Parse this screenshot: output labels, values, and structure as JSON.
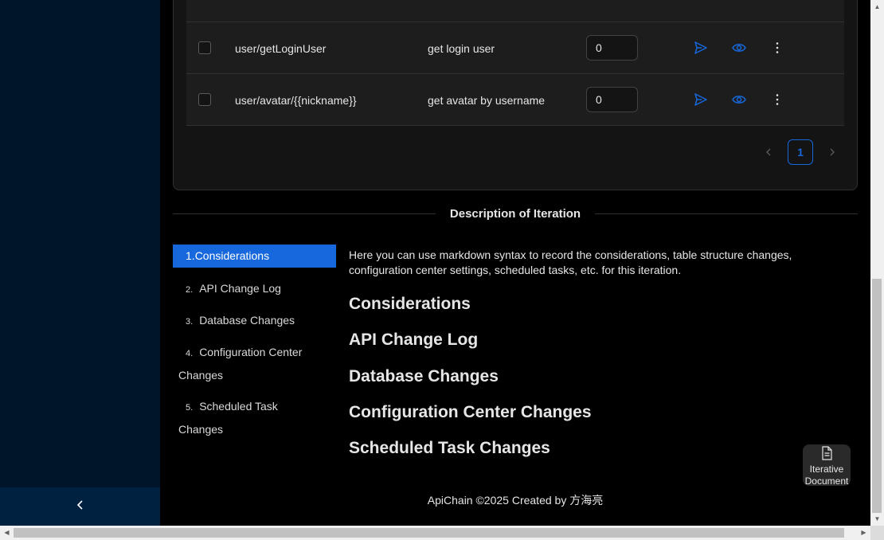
{
  "sidebar": {
    "collapse_icon": "chevron-left-icon"
  },
  "table": {
    "rows": [
      {
        "path": "user/getLoginUser",
        "description": "get login user",
        "value": "0"
      },
      {
        "path": "user/avatar/{{nickname}}",
        "description": "get avatar by username",
        "value": "0"
      }
    ],
    "row_icons": [
      "send-icon",
      "eye-icon",
      "more-vertical-icon"
    ]
  },
  "pagination": {
    "current_page": "1"
  },
  "section": {
    "title": "Description of Iteration"
  },
  "toc": {
    "items": [
      {
        "num": "1.",
        "label": "Considerations"
      },
      {
        "num": "2.",
        "label": "API Change Log"
      },
      {
        "num": "3.",
        "label": "Database Changes"
      },
      {
        "num": "4.",
        "label": "Configuration Center",
        "label2": "Changes"
      },
      {
        "num": "5.",
        "label": "Scheduled Task",
        "label2": "Changes"
      }
    ]
  },
  "content": {
    "intro": "Here you can use markdown syntax to record the considerations, table structure changes, configuration center settings, scheduled tasks, etc. for this iteration.",
    "headings": [
      "Considerations",
      "API Change Log",
      "Database Changes",
      "Configuration Center Changes",
      "Scheduled Task Changes"
    ]
  },
  "float_button": {
    "line1": "Iterative",
    "line2": "Document"
  },
  "footer": {
    "text": "ApiChain ©2025 Created by 方海亮"
  },
  "colors": {
    "accent": "#1668dc",
    "sidebar_bg": "#001529",
    "card_bg": "#141414"
  }
}
